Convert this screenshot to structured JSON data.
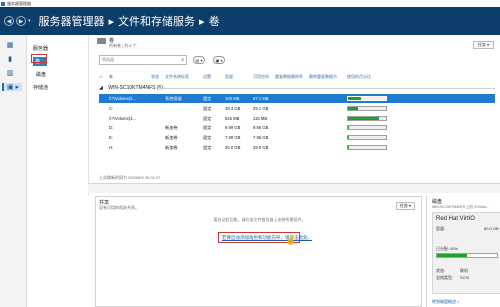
{
  "window": {
    "title": "服务器管理器"
  },
  "header": {
    "breadcrumb": [
      "服务器管理器",
      "文件和存储服务",
      "卷"
    ],
    "back_glyph": "◀",
    "forward_glyph": "▶",
    "dropdown_glyph": "▾"
  },
  "rail": {
    "icons": [
      "dashboard-icon",
      "local-server-icon",
      "all-servers-icon",
      "file-storage-icon"
    ]
  },
  "subnav": {
    "items": [
      {
        "label": "服务器"
      },
      {
        "label": "卷"
      },
      {
        "label": "磁盘"
      },
      {
        "label": "存储池"
      }
    ]
  },
  "volumes": {
    "title": "卷",
    "subtitle": "所有卷 | 共 6 个",
    "tasks_label": "任务 ▾",
    "filter_placeholder": "筛选器",
    "filter_btn1": "▤ ▾",
    "filter_btn2": "▣ ▾",
    "columns": [
      "卷",
      "状态",
      "文件系统标签",
      "设置",
      "容量",
      "可用空间",
      "重复数据删除率",
      "删除重复数据节",
      "使用的百分比"
    ],
    "group": "WIN-SC10KTM4NFS (6)",
    "rows": [
      {
        "vol": "\\\\?\\Volume{3...",
        "status": "",
        "label": "系统保留",
        "prov": "固定",
        "cap": "100 MB",
        "free": "67.1 MB",
        "pct": 0.33,
        "selected": true
      },
      {
        "vol": "C:",
        "status": "",
        "label": "",
        "prov": "固定",
        "cap": "39.3 GB",
        "free": "29.1 GB",
        "pct": 0.26,
        "selected": false
      },
      {
        "vol": "\\\\?\\Volume{3...",
        "status": "",
        "label": "",
        "prov": "固定",
        "cap": "616 MB",
        "free": "115 MB",
        "pct": 0.81,
        "selected": false
      },
      {
        "vol": "D:",
        "status": "",
        "label": "新加卷",
        "prov": "固定",
        "cap": "9.99 GB",
        "free": "9.96 GB",
        "pct": 0.01,
        "selected": false
      },
      {
        "vol": "E:",
        "status": "",
        "label": "新加卷",
        "prov": "固定",
        "cap": "7.99 GB",
        "free": "7.96 GB",
        "pct": 0.01,
        "selected": false
      },
      {
        "vol": "H:",
        "status": "",
        "label": "新加卷",
        "prov": "固定",
        "cap": "30.0 GB",
        "free": "29.9 GB",
        "pct": 0.01,
        "selected": false
      }
    ],
    "status_text": "上次刷新时间为 2023/8/9 20:01:27"
  },
  "shares": {
    "title": "共享",
    "subtitle": "没有可用的相关共享。",
    "tasks_label": "任务 ▾",
    "empty_text": "要启动此功能，请在该文件服务器上安装所需组件。",
    "link": "若要启动添加角色和功能向导，请单击此处。",
    "cursor_glyph": "☝"
  },
  "disk": {
    "title": "磁盘",
    "subtitle": "WIN-SC10KTM4NFS 上的 \\\\?\\Volu...",
    "name": "Red Hat VirtIO",
    "capacity_label": "容量:",
    "capacity_value": "80.0 GB",
    "allocated_label": "已分配: 50%",
    "status_label": "状态:",
    "status_value": "联机",
    "bus_label": "总线类型:",
    "bus_value": "SCSI",
    "allocated_fraction": 0.5,
    "footer": "转到磁盘概述 >"
  }
}
